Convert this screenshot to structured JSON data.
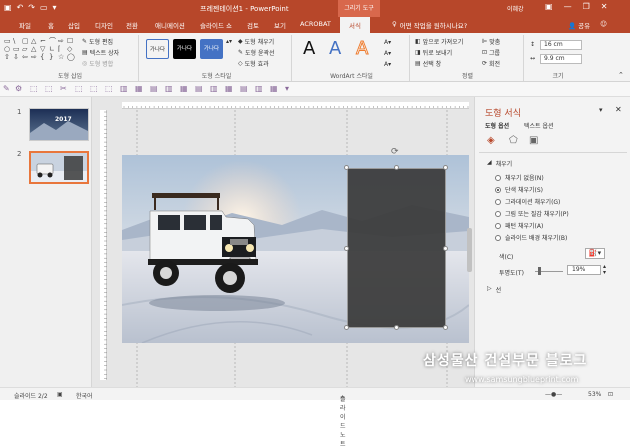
{
  "titlebar": {
    "title": "프레젠테이션1 - PowerPoint",
    "context_tool": "그리기 도구",
    "user": "이혜강",
    "accent": "#b7472a"
  },
  "tabs": [
    "파일",
    "홈",
    "삽입",
    "디자인",
    "전환",
    "애니메이션",
    "슬라이드 쇼",
    "검토",
    "보기",
    "ACROBAT",
    "서식"
  ],
  "tell_me": "어떤 작업을 원하시나요?",
  "share": "공유",
  "ribbon": {
    "insert_shapes": {
      "label": "도형 삽입",
      "edit_shape": "도형 편집",
      "text_box": "텍스트 상자",
      "merge_shapes": "도형 병합",
      "shape_glyphs": [
        "▭",
        "\\",
        "▢",
        "△",
        "⌐",
        "⌒",
        "⇨",
        "☐",
        "○",
        "▭",
        "▱",
        "△",
        "▽",
        "∟",
        "⌈",
        "◇",
        "⇧",
        "⇩",
        "⇦",
        "⇨",
        "{",
        "}",
        "☆",
        "◯"
      ]
    },
    "shape_styles": {
      "label": "도형 스타일",
      "swatches": [
        {
          "text": "가나다",
          "bg": "#ffffff",
          "fg": "#333333"
        },
        {
          "text": "가나다",
          "bg": "#000000",
          "fg": "#ffffff"
        },
        {
          "text": "가나다",
          "bg": "#4472c4",
          "fg": "#ffffff"
        }
      ],
      "fill": "도형 채우기",
      "outline": "도형 윤곽선",
      "effects": "도형 효과"
    },
    "wordart": {
      "label": "WordArt 스타일",
      "glyph": "A"
    },
    "arrange": {
      "label": "정렬",
      "bring_forward": "앞으로 가져오기",
      "send_backward": "뒤로 보내기",
      "selection_pane": "선택 창",
      "align": "맞춤",
      "group": "그룹",
      "rotate": "회전"
    },
    "size": {
      "label": "크기",
      "height": "16 cm",
      "width": "9.9 cm"
    }
  },
  "slides": [
    {
      "num": "1",
      "title_text": "2017"
    },
    {
      "num": "2"
    }
  ],
  "format_pane": {
    "title": "도형 서식",
    "tab_shape": "도형 옵션",
    "tab_text": "텍스트 옵션",
    "fill_section": "채우기",
    "options": [
      "채우기 없음(N)",
      "단색 채우기(S)",
      "그라데이션 채우기(G)",
      "그림 또는 질감 채우기(P)",
      "패턴 채우기(A)",
      "슬라이드 배경 채우기(B)"
    ],
    "selected_index": 1,
    "color_label": "색(C)",
    "transparency_label": "투명도(T)",
    "transparency_value": "19%",
    "transparency": 0.19,
    "line_section": "선"
  },
  "car_plate": "FAL RHOE",
  "statusbar": {
    "slide": "슬라이드 2/2",
    "language": "한국어",
    "notes": "슬라이드 노트",
    "zoom": "53%"
  },
  "watermark": {
    "line1": "삼성물산 건설부문 블로그",
    "line2": "www.samsungblueprint.com"
  }
}
